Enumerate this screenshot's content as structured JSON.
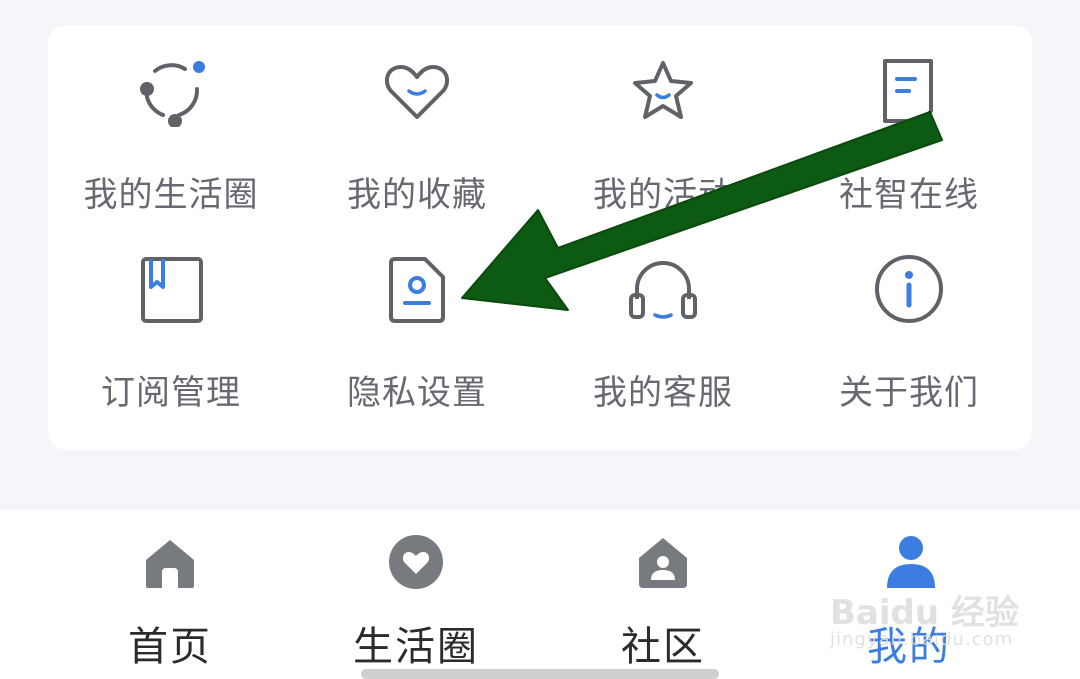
{
  "colors": {
    "accent": "#3b7de0",
    "icon_gray": "#5f6368",
    "label_gray": "#666a70",
    "arrow_green": "#0d5a12",
    "page_bg": "#f4f6fa"
  },
  "grid": {
    "items": [
      {
        "label": "我的生活圈",
        "icon": "circle-network-icon"
      },
      {
        "label": "我的收藏",
        "icon": "heart-icon"
      },
      {
        "label": "我的活动",
        "icon": "star-icon"
      },
      {
        "label": "社智在线",
        "icon": "document-icon"
      },
      {
        "label": "订阅管理",
        "icon": "bookmark-book-icon"
      },
      {
        "label": "隐私设置",
        "icon": "privacy-file-icon"
      },
      {
        "label": "我的客服",
        "icon": "headphones-icon"
      },
      {
        "label": "关于我们",
        "icon": "info-icon"
      }
    ]
  },
  "tabbar": {
    "tabs": [
      {
        "label": "首页",
        "icon": "home-icon"
      },
      {
        "label": "生活圈",
        "icon": "heart-location-icon"
      },
      {
        "label": "社区",
        "icon": "community-house-icon"
      },
      {
        "label": "我的",
        "icon": "user-group-icon",
        "active": true
      }
    ]
  },
  "watermark": {
    "main": "Baidu 经验",
    "sub": "jingyan.baidu.com"
  }
}
